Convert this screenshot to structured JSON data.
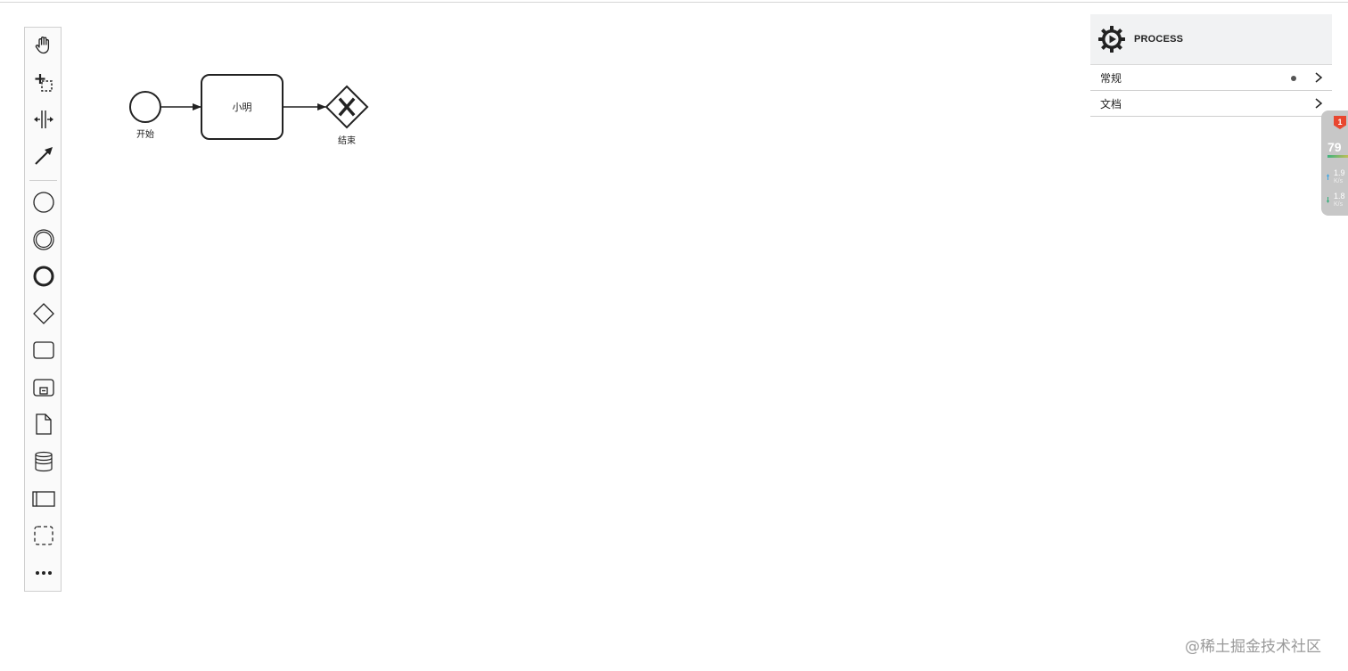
{
  "diagram": {
    "start_event_label": "开始",
    "task_label": "小明",
    "end_gateway_label": "结束"
  },
  "palette": {
    "tools": [
      "hand-tool-icon",
      "lasso-tool-icon",
      "space-tool-icon",
      "global-connect-tool-icon",
      "create-start-event-icon",
      "create-intermediate-event-icon",
      "create-end-event-icon",
      "create-gateway-icon",
      "create-task-icon",
      "create-subprocess-icon",
      "create-data-object-icon",
      "create-data-store-icon",
      "create-pool-icon",
      "create-group-icon",
      "more-tools-icon"
    ]
  },
  "properties": {
    "title": "PROCESS",
    "groups": [
      {
        "label": "常规",
        "has_indicator": true
      },
      {
        "label": "文档",
        "has_indicator": false
      }
    ]
  },
  "net_widget": {
    "badge": "1",
    "score": "79",
    "upload": "1.9",
    "upload_unit": "K/s",
    "download": "1.8",
    "download_unit": "K/s"
  },
  "watermark": "@稀土掘金技术社区",
  "colors": {
    "stroke": "#222222",
    "panel_header": "#f1f2f3",
    "badge": "#e8462f"
  }
}
